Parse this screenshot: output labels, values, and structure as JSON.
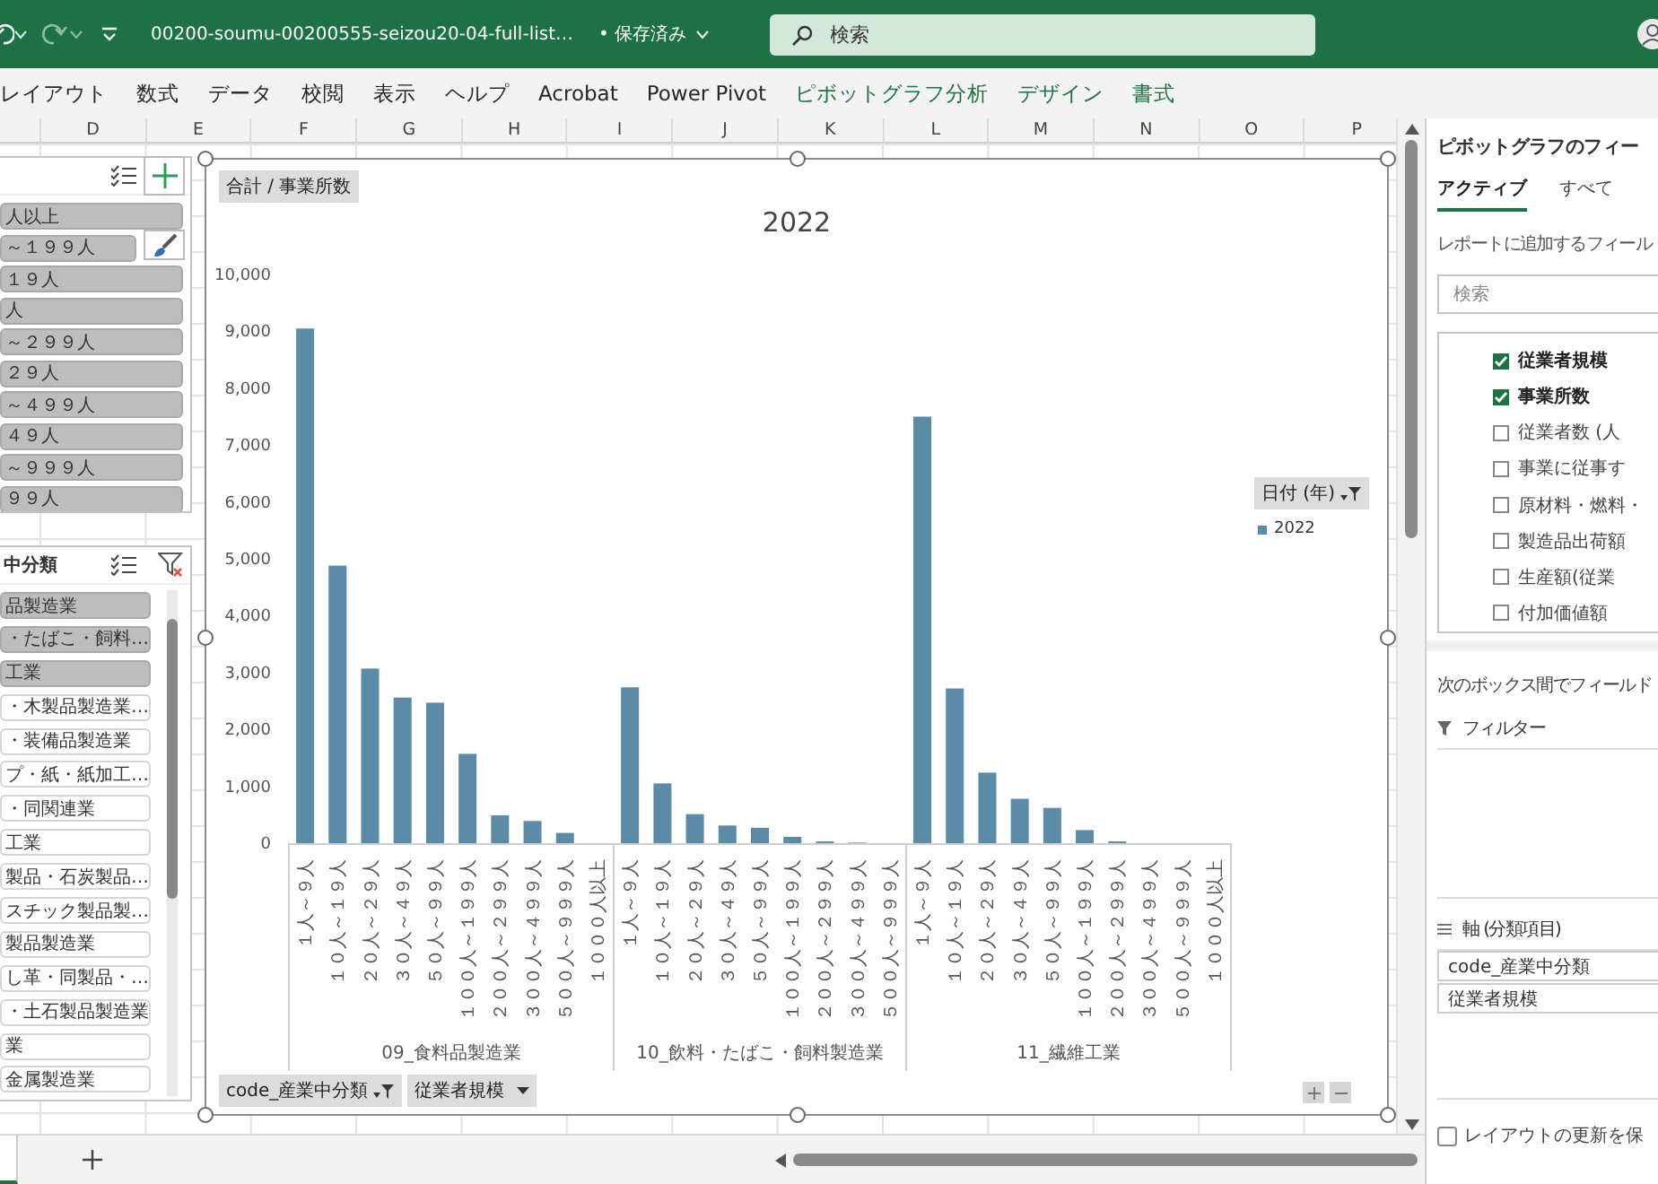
{
  "title_bar": {
    "file_name": "00200-soumu-00200555-seizou20-04-full-list…",
    "save_status": "• 保存済み",
    "search": {
      "placeholder": "検索"
    }
  },
  "ribbon_tabs": [
    {
      "label": "レイアウト",
      "kind": "standard"
    },
    {
      "label": "数式",
      "kind": "standard"
    },
    {
      "label": "データ",
      "kind": "standard"
    },
    {
      "label": "校閲",
      "kind": "standard"
    },
    {
      "label": "表示",
      "kind": "standard"
    },
    {
      "label": "ヘルプ",
      "kind": "standard"
    },
    {
      "label": "Acrobat",
      "kind": "standard"
    },
    {
      "label": "Power Pivot",
      "kind": "standard"
    },
    {
      "label": "ピボットグラフ分析",
      "kind": "contextual"
    },
    {
      "label": "デザイン",
      "kind": "contextual"
    },
    {
      "label": "書式",
      "kind": "contextual"
    }
  ],
  "column_headers": [
    "D",
    "E",
    "F",
    "G",
    "H",
    "I",
    "J",
    "K",
    "L",
    "M",
    "N",
    "O",
    "P"
  ],
  "slicers": [
    {
      "items": [
        {
          "label": "人以上",
          "selected": true
        },
        {
          "label": "～１９９人",
          "selected": true
        },
        {
          "label": "１９人",
          "selected": true
        },
        {
          "label": "人",
          "selected": true
        },
        {
          "label": "～２９９人",
          "selected": true
        },
        {
          "label": "２９人",
          "selected": true
        },
        {
          "label": "～４９９人",
          "selected": true
        },
        {
          "label": "４９人",
          "selected": true
        },
        {
          "label": "～９９９人",
          "selected": true
        },
        {
          "label": "９９人",
          "selected": true
        }
      ]
    },
    {
      "title": "中分類",
      "items": [
        {
          "label": "品製造業",
          "selected": true
        },
        {
          "label": "・たばこ・飼料…",
          "selected": true
        },
        {
          "label": "工業",
          "selected": true
        },
        {
          "label": "・木製品製造業…",
          "selected": false
        },
        {
          "label": "・装備品製造業",
          "selected": false
        },
        {
          "label": "プ・紙・紙加工…",
          "selected": false
        },
        {
          "label": "・同関連業",
          "selected": false
        },
        {
          "label": "工業",
          "selected": false
        },
        {
          "label": "製品・石炭製品…",
          "selected": false
        },
        {
          "label": "スチック製品製…",
          "selected": false
        },
        {
          "label": "製品製造業",
          "selected": false
        },
        {
          "label": "し革・同製品・…",
          "selected": false
        },
        {
          "label": "・土石製品製造業",
          "selected": false
        },
        {
          "label": "業",
          "selected": false
        },
        {
          "label": "金属製造業",
          "selected": false
        }
      ]
    }
  ],
  "chart": {
    "field_button": "合計 / 事業所数",
    "legend_field_button": "日付 (年)",
    "axis_field_buttons": [
      "code_産業中分類",
      "従業者規模"
    ],
    "chart_data": {
      "type": "bar",
      "title": "2022",
      "categories": [
        "１人～９人",
        "１０人～１９人",
        "２０人～２９人",
        "３０人～４９人",
        "５０人～９９人",
        "１００人～１９９人",
        "２００人～２９９人",
        "３００人～４９９人",
        "５００人～９９９人",
        "１０００人以上",
        "１人～９人",
        "１０人～１９人",
        "２０人～２９人",
        "３０人～４９人",
        "５０人～９９人",
        "１００人～１９９人",
        "２００人～２９９人",
        "３００人～４９９人",
        "５００人～９９９人",
        "１人～９人",
        "１０人～１９人",
        "２０人～２９人",
        "３０人～４９人",
        "５０人～９９人",
        "１００人～１９９人",
        "２００人～２９９人",
        "３００人～４９９人",
        "５００人～９９９人",
        "１０００人以上"
      ],
      "annotations": [
        "09_食料品製造業",
        "10_飲料・たばこ・飼料製造業",
        "11_繊維工業"
      ],
      "series": [
        {
          "name": "2022",
          "color": "#5b8ba6",
          "values": [
            9050,
            4880,
            3070,
            2560,
            2470,
            1570,
            490,
            390,
            180,
            0,
            2740,
            1050,
            510,
            310,
            270,
            110,
            30,
            10,
            0,
            7500,
            2720,
            1240,
            780,
            620,
            230,
            30,
            0,
            0,
            0
          ]
        }
      ],
      "ylim": [
        0,
        10000
      ],
      "yticks": [
        {
          "value": 0,
          "label": "0"
        },
        {
          "value": 1000,
          "label": "1,000"
        },
        {
          "value": 2000,
          "label": "2,000"
        },
        {
          "value": 3000,
          "label": "3,000"
        },
        {
          "value": 4000,
          "label": "4,000"
        },
        {
          "value": 5000,
          "label": "5,000"
        },
        {
          "value": 6000,
          "label": "6,000"
        },
        {
          "value": 7000,
          "label": "7,000"
        },
        {
          "value": 8000,
          "label": "8,000"
        },
        {
          "value": 9000,
          "label": "9,000"
        },
        {
          "value": 10000,
          "label": "10,000"
        }
      ]
    }
  },
  "field_pane": {
    "title": "ピボットグラフのフィー",
    "tabs": [
      {
        "label": "アクティブ",
        "selected": true
      },
      {
        "label": "すべて",
        "selected": false
      }
    ],
    "description": "レポートに追加するフィール",
    "search": {
      "placeholder": "検索"
    },
    "fields": [
      {
        "label": "従業者規模",
        "checked": true
      },
      {
        "label": "事業所数",
        "checked": true
      },
      {
        "label": "従業者数 (人",
        "checked": false
      },
      {
        "label": "事業に従事す",
        "checked": false
      },
      {
        "label": "原材料・燃料・",
        "checked": false
      },
      {
        "label": "製造品出荷額",
        "checked": false
      },
      {
        "label": "生産額(従業",
        "checked": false
      },
      {
        "label": "付加価値額",
        "checked": false
      }
    ],
    "areas_hint": "次のボックス間でフィールド",
    "areas": [
      {
        "kind": "filter",
        "label": "フィルター"
      },
      {
        "kind": "axis",
        "label": "軸 (分類項目)",
        "items": [
          "code_産業中分類",
          "従業者規模"
        ]
      }
    ],
    "defer_update": {
      "label": "レイアウトの更新を保",
      "checked": false
    }
  }
}
